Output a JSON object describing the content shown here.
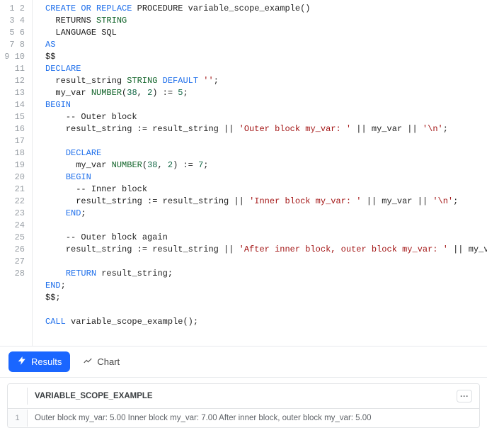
{
  "editor": {
    "line_count": 28,
    "lines": [
      {
        "tokens": [
          [
            "kw",
            "CREATE"
          ],
          [
            "sp",
            " "
          ],
          [
            "kw",
            "OR"
          ],
          [
            "sp",
            " "
          ],
          [
            "kw",
            "REPLACE"
          ],
          [
            "sp",
            " "
          ],
          [
            "ident",
            "PROCEDURE variable_scope_example()"
          ]
        ]
      },
      {
        "indent": "  ",
        "tokens": [
          [
            "ident",
            "RETURNS "
          ],
          [
            "type",
            "STRING"
          ]
        ]
      },
      {
        "indent": "  ",
        "tokens": [
          [
            "ident",
            "LANGUAGE SQL"
          ]
        ]
      },
      {
        "tokens": [
          [
            "kw",
            "AS"
          ]
        ]
      },
      {
        "tokens": [
          [
            "ident",
            "$$"
          ]
        ]
      },
      {
        "tokens": [
          [
            "kw",
            "DECLARE"
          ]
        ]
      },
      {
        "indent": "  ",
        "tokens": [
          [
            "ident",
            "result_string "
          ],
          [
            "type",
            "STRING"
          ],
          [
            "ident",
            " "
          ],
          [
            "kw",
            "DEFAULT"
          ],
          [
            "ident",
            " "
          ],
          [
            "str",
            "''"
          ],
          [
            "ident",
            ";"
          ]
        ]
      },
      {
        "indent": "  ",
        "tokens": [
          [
            "ident",
            "my_var "
          ],
          [
            "type",
            "NUMBER"
          ],
          [
            "ident",
            "("
          ],
          [
            "num",
            "38"
          ],
          [
            "ident",
            ", "
          ],
          [
            "num",
            "2"
          ],
          [
            "ident",
            ") := "
          ],
          [
            "num",
            "5"
          ],
          [
            "ident",
            ";"
          ]
        ]
      },
      {
        "tokens": [
          [
            "kw",
            "BEGIN"
          ]
        ]
      },
      {
        "indent": "    ",
        "tokens": [
          [
            "ident",
            "-- Outer block"
          ]
        ]
      },
      {
        "indent": "    ",
        "tokens": [
          [
            "ident",
            "result_string := result_string || "
          ],
          [
            "str",
            "'Outer block my_var: '"
          ],
          [
            "ident",
            " || my_var || "
          ],
          [
            "str",
            "'\\n'"
          ],
          [
            "ident",
            ";"
          ]
        ]
      },
      {
        "tokens": []
      },
      {
        "indent": "    ",
        "tokens": [
          [
            "kw",
            "DECLARE"
          ]
        ]
      },
      {
        "indent": "      ",
        "tokens": [
          [
            "ident",
            "my_var "
          ],
          [
            "type",
            "NUMBER"
          ],
          [
            "ident",
            "("
          ],
          [
            "num",
            "38"
          ],
          [
            "ident",
            ", "
          ],
          [
            "num",
            "2"
          ],
          [
            "ident",
            ") := "
          ],
          [
            "num",
            "7"
          ],
          [
            "ident",
            ";"
          ]
        ]
      },
      {
        "indent": "    ",
        "tokens": [
          [
            "kw",
            "BEGIN"
          ]
        ]
      },
      {
        "indent": "      ",
        "tokens": [
          [
            "ident",
            "-- Inner block"
          ]
        ]
      },
      {
        "indent": "      ",
        "tokens": [
          [
            "ident",
            "result_string := result_string || "
          ],
          [
            "str",
            "'Inner block my_var: '"
          ],
          [
            "ident",
            " || my_var || "
          ],
          [
            "str",
            "'\\n'"
          ],
          [
            "ident",
            ";"
          ]
        ]
      },
      {
        "indent": "    ",
        "tokens": [
          [
            "kw",
            "END"
          ],
          [
            "ident",
            ";"
          ]
        ]
      },
      {
        "tokens": []
      },
      {
        "indent": "    ",
        "tokens": [
          [
            "ident",
            "-- Outer block again"
          ]
        ]
      },
      {
        "indent": "    ",
        "tokens": [
          [
            "ident",
            "result_string := result_string || "
          ],
          [
            "str",
            "'After inner block, outer block my_var: '"
          ],
          [
            "ident",
            " || my_var;"
          ]
        ]
      },
      {
        "tokens": []
      },
      {
        "indent": "    ",
        "tokens": [
          [
            "kw",
            "RETURN"
          ],
          [
            "ident",
            " result_string;"
          ]
        ]
      },
      {
        "tokens": [
          [
            "kw",
            "END"
          ],
          [
            "ident",
            ";"
          ]
        ]
      },
      {
        "tokens": [
          [
            "ident",
            "$$;"
          ]
        ]
      },
      {
        "tokens": []
      },
      {
        "tokens": [
          [
            "kw",
            "CALL"
          ],
          [
            "ident",
            " variable_scope_example();"
          ]
        ]
      },
      {
        "tokens": []
      }
    ]
  },
  "toolbar": {
    "results_label": "Results",
    "chart_label": "Chart"
  },
  "results": {
    "column_header": "VARIABLE_SCOPE_EXAMPLE",
    "more_label": "···",
    "rows": [
      {
        "num": "1",
        "value": "Outer block my_var: 5.00 Inner block my_var: 7.00 After inner block, outer block my_var: 5.00"
      }
    ]
  }
}
